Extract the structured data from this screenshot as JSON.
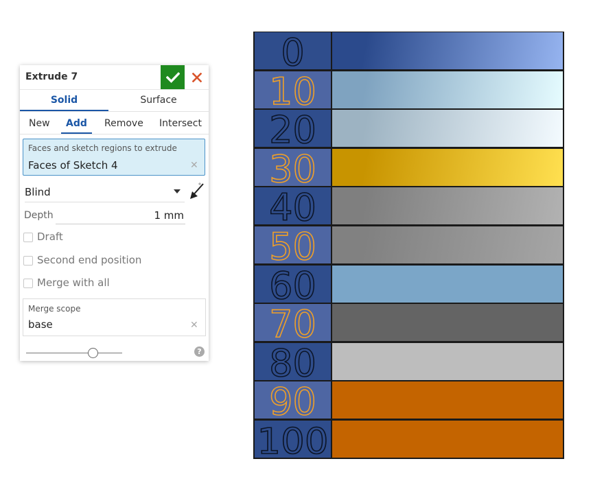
{
  "dialog": {
    "title": "Extrude 7",
    "accept_icon": "checkmark-icon",
    "cancel_icon": "close-icon",
    "type_tabs": [
      {
        "label": "Solid",
        "active": true
      },
      {
        "label": "Surface",
        "active": false
      }
    ],
    "operation_tabs": [
      {
        "label": "New",
        "active": false
      },
      {
        "label": "Add",
        "active": true
      },
      {
        "label": "Remove",
        "active": false
      },
      {
        "label": "Intersect",
        "active": false
      }
    ],
    "selection": {
      "label": "Faces and sketch regions to extrude",
      "value": "Faces of Sketch 4"
    },
    "end_type": "Blind",
    "depth": {
      "label": "Depth",
      "value": "1 mm"
    },
    "options": [
      {
        "label": "Draft",
        "checked": false
      },
      {
        "label": "Second end position",
        "checked": false
      },
      {
        "label": "Merge with all",
        "checked": false
      }
    ],
    "merge_scope": {
      "label": "Merge scope",
      "value": "base"
    },
    "slider_value": 0.69,
    "help_symbol": "?"
  },
  "colors": {
    "accent": "#1a56a6",
    "accept_green": "#1f8a1f",
    "cancel_red": "#d9542b",
    "selection_bg": "#d9eef7",
    "number_cell": "#2f4d8c",
    "highlight_outline": "#f0a028"
  },
  "color_bars": [
    {
      "label": "0",
      "highlight": false,
      "color_from": "#2b4a8c",
      "color_to": "#96b4f0"
    },
    {
      "label": "10",
      "highlight": true,
      "color_from": "#7fa3c0",
      "color_to": "#e6fcff"
    },
    {
      "label": "20",
      "highlight": false,
      "color_from": "#9db3c2",
      "color_to": "#f4fbff"
    },
    {
      "label": "30",
      "highlight": true,
      "color_from": "#c89400",
      "color_to": "#ffe050"
    },
    {
      "label": "40",
      "highlight": false,
      "color_from": "#7f7f7f",
      "color_to": "#b2b2b2"
    },
    {
      "label": "50",
      "highlight": true,
      "color_from": "#818181",
      "color_to": "#a6a6a6"
    },
    {
      "label": "60",
      "highlight": false,
      "color_from": "#7ba6c8",
      "color_to": "#7ba6c8"
    },
    {
      "label": "70",
      "highlight": true,
      "color_from": "#646464",
      "color_to": "#646464"
    },
    {
      "label": "80",
      "highlight": false,
      "color_from": "#bdbdbd",
      "color_to": "#bdbdbd"
    },
    {
      "label": "90",
      "highlight": true,
      "color_from": "#c46400",
      "color_to": "#c46400"
    },
    {
      "label": "100",
      "highlight": false,
      "color_from": "#c46400",
      "color_to": "#c46400"
    }
  ]
}
